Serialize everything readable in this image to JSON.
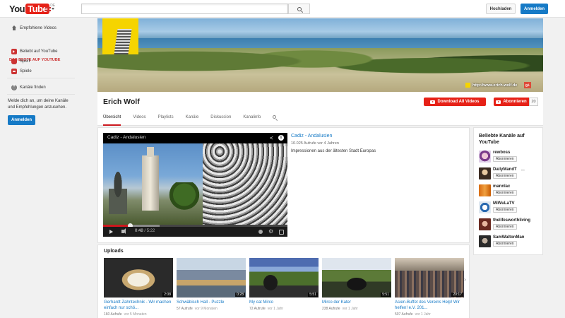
{
  "masthead": {
    "logo_you": "You",
    "logo_tube": "Tube",
    "logo_region": "DE",
    "search_placeholder": "",
    "upload_label": "Hochladen",
    "signin_label": "Anmelden"
  },
  "guide": {
    "recommended": "Empfohlene Videos",
    "section_title": "DAS BESTE AUF YOUTUBE",
    "items": [
      {
        "label": "Beliebt auf YouTube",
        "icon": "popular-icon"
      },
      {
        "label": "Sport",
        "icon": "sports-icon"
      },
      {
        "label": "Spiele",
        "icon": "games-icon"
      }
    ],
    "find_channels": "Kanäle finden",
    "signin_note": "Melde dich an, um deine Kanäle und Empfehlungen anzusehen.",
    "signin_label": "Anmelden"
  },
  "channel": {
    "name": "Erich Wolf",
    "website": "http://www.erich-wolf.de",
    "gplus_label": "g+",
    "download_label": "Download All Videos",
    "subscribe_label": "Abonnieren",
    "subscriber_count": "20",
    "tabs": [
      "Übersicht",
      "Videos",
      "Playlists",
      "Kanäle",
      "Diskussion",
      "Kanalinfo"
    ],
    "active_tab": "Übersicht"
  },
  "featured": {
    "player_title": "Cadiz - Andalusien",
    "title": "Cadiz - Andalusien",
    "views": "10.025 Aufrufe",
    "age": "vor 4 Jahren",
    "description": "Impressionen aus der ältesten Stadt Europas",
    "time_current": "0:48",
    "time_total": "5:22",
    "progress_fraction": 0.149
  },
  "popular_channels": {
    "title": "Beliebte Kanäle auf YouTube",
    "subscribe_label": "Abonnieren",
    "items": [
      {
        "name": "rewboss",
        "extra": ""
      },
      {
        "name": "DailyMandT",
        "extra": "▭"
      },
      {
        "name": "mannlac",
        "extra": ""
      },
      {
        "name": "MiWuLaTV",
        "extra": ""
      },
      {
        "name": "thelifesworthliving",
        "extra": ""
      },
      {
        "name": "SamWaltonMan",
        "extra": ""
      }
    ]
  },
  "uploads": {
    "title": "Uploads",
    "videos": [
      {
        "title": "Gerhardt Zahntechnik - Wir machen einfach nur schö...",
        "views": "160 Aufrufe",
        "age": "vor 5 Monaten",
        "duration": "2:08"
      },
      {
        "title": "Schwäbisch Hall - Puzzle",
        "views": "57 Aufrufe",
        "age": "vor 9 Monaten",
        "duration": "0:28"
      },
      {
        "title": "My cat Mirco",
        "views": "72 Aufrufe",
        "age": "vor 1 Jahr",
        "duration": "5:51"
      },
      {
        "title": "Mirco der Kater",
        "views": "238 Aufrufe",
        "age": "vor 1 Jahr",
        "duration": "5:51"
      },
      {
        "title": "Asien-Buffet des Vereins Help! Wir helfen! e.V. 201...",
        "views": "507 Aufrufe",
        "age": "vor 1 Jahr",
        "duration": "20:17"
      }
    ]
  },
  "colors": {
    "brand_red": "#e62117",
    "link_blue": "#167ac6"
  }
}
